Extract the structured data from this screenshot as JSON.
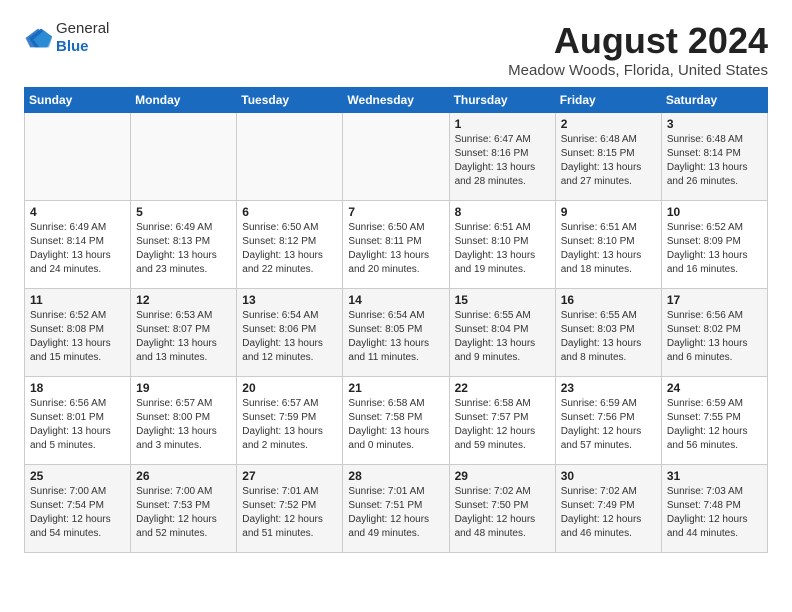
{
  "logo": {
    "general": "General",
    "blue": "Blue"
  },
  "title": "August 2024",
  "subtitle": "Meadow Woods, Florida, United States",
  "days_of_week": [
    "Sunday",
    "Monday",
    "Tuesday",
    "Wednesday",
    "Thursday",
    "Friday",
    "Saturday"
  ],
  "weeks": [
    [
      {
        "day": "",
        "info": ""
      },
      {
        "day": "",
        "info": ""
      },
      {
        "day": "",
        "info": ""
      },
      {
        "day": "",
        "info": ""
      },
      {
        "day": "1",
        "info": "Sunrise: 6:47 AM\nSunset: 8:16 PM\nDaylight: 13 hours\nand 28 minutes."
      },
      {
        "day": "2",
        "info": "Sunrise: 6:48 AM\nSunset: 8:15 PM\nDaylight: 13 hours\nand 27 minutes."
      },
      {
        "day": "3",
        "info": "Sunrise: 6:48 AM\nSunset: 8:14 PM\nDaylight: 13 hours\nand 26 minutes."
      }
    ],
    [
      {
        "day": "4",
        "info": "Sunrise: 6:49 AM\nSunset: 8:14 PM\nDaylight: 13 hours\nand 24 minutes."
      },
      {
        "day": "5",
        "info": "Sunrise: 6:49 AM\nSunset: 8:13 PM\nDaylight: 13 hours\nand 23 minutes."
      },
      {
        "day": "6",
        "info": "Sunrise: 6:50 AM\nSunset: 8:12 PM\nDaylight: 13 hours\nand 22 minutes."
      },
      {
        "day": "7",
        "info": "Sunrise: 6:50 AM\nSunset: 8:11 PM\nDaylight: 13 hours\nand 20 minutes."
      },
      {
        "day": "8",
        "info": "Sunrise: 6:51 AM\nSunset: 8:10 PM\nDaylight: 13 hours\nand 19 minutes."
      },
      {
        "day": "9",
        "info": "Sunrise: 6:51 AM\nSunset: 8:10 PM\nDaylight: 13 hours\nand 18 minutes."
      },
      {
        "day": "10",
        "info": "Sunrise: 6:52 AM\nSunset: 8:09 PM\nDaylight: 13 hours\nand 16 minutes."
      }
    ],
    [
      {
        "day": "11",
        "info": "Sunrise: 6:52 AM\nSunset: 8:08 PM\nDaylight: 13 hours\nand 15 minutes."
      },
      {
        "day": "12",
        "info": "Sunrise: 6:53 AM\nSunset: 8:07 PM\nDaylight: 13 hours\nand 13 minutes."
      },
      {
        "day": "13",
        "info": "Sunrise: 6:54 AM\nSunset: 8:06 PM\nDaylight: 13 hours\nand 12 minutes."
      },
      {
        "day": "14",
        "info": "Sunrise: 6:54 AM\nSunset: 8:05 PM\nDaylight: 13 hours\nand 11 minutes."
      },
      {
        "day": "15",
        "info": "Sunrise: 6:55 AM\nSunset: 8:04 PM\nDaylight: 13 hours\nand 9 minutes."
      },
      {
        "day": "16",
        "info": "Sunrise: 6:55 AM\nSunset: 8:03 PM\nDaylight: 13 hours\nand 8 minutes."
      },
      {
        "day": "17",
        "info": "Sunrise: 6:56 AM\nSunset: 8:02 PM\nDaylight: 13 hours\nand 6 minutes."
      }
    ],
    [
      {
        "day": "18",
        "info": "Sunrise: 6:56 AM\nSunset: 8:01 PM\nDaylight: 13 hours\nand 5 minutes."
      },
      {
        "day": "19",
        "info": "Sunrise: 6:57 AM\nSunset: 8:00 PM\nDaylight: 13 hours\nand 3 minutes."
      },
      {
        "day": "20",
        "info": "Sunrise: 6:57 AM\nSunset: 7:59 PM\nDaylight: 13 hours\nand 2 minutes."
      },
      {
        "day": "21",
        "info": "Sunrise: 6:58 AM\nSunset: 7:58 PM\nDaylight: 13 hours\nand 0 minutes."
      },
      {
        "day": "22",
        "info": "Sunrise: 6:58 AM\nSunset: 7:57 PM\nDaylight: 12 hours\nand 59 minutes."
      },
      {
        "day": "23",
        "info": "Sunrise: 6:59 AM\nSunset: 7:56 PM\nDaylight: 12 hours\nand 57 minutes."
      },
      {
        "day": "24",
        "info": "Sunrise: 6:59 AM\nSunset: 7:55 PM\nDaylight: 12 hours\nand 56 minutes."
      }
    ],
    [
      {
        "day": "25",
        "info": "Sunrise: 7:00 AM\nSunset: 7:54 PM\nDaylight: 12 hours\nand 54 minutes."
      },
      {
        "day": "26",
        "info": "Sunrise: 7:00 AM\nSunset: 7:53 PM\nDaylight: 12 hours\nand 52 minutes."
      },
      {
        "day": "27",
        "info": "Sunrise: 7:01 AM\nSunset: 7:52 PM\nDaylight: 12 hours\nand 51 minutes."
      },
      {
        "day": "28",
        "info": "Sunrise: 7:01 AM\nSunset: 7:51 PM\nDaylight: 12 hours\nand 49 minutes."
      },
      {
        "day": "29",
        "info": "Sunrise: 7:02 AM\nSunset: 7:50 PM\nDaylight: 12 hours\nand 48 minutes."
      },
      {
        "day": "30",
        "info": "Sunrise: 7:02 AM\nSunset: 7:49 PM\nDaylight: 12 hours\nand 46 minutes."
      },
      {
        "day": "31",
        "info": "Sunrise: 7:03 AM\nSunset: 7:48 PM\nDaylight: 12 hours\nand 44 minutes."
      }
    ]
  ]
}
